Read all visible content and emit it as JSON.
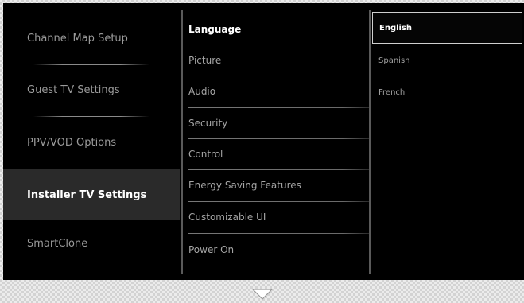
{
  "left_menu": {
    "items": [
      {
        "label": "Channel Map Setup"
      },
      {
        "label": "Guest TV Settings"
      },
      {
        "label": "PPV/VOD Options"
      },
      {
        "label": "Installer TV Settings",
        "selected": true
      },
      {
        "label": "SmartClone"
      }
    ]
  },
  "middle_menu": {
    "items": [
      {
        "label": "Language",
        "selected": true
      },
      {
        "label": "Picture"
      },
      {
        "label": "Audio"
      },
      {
        "label": "Security"
      },
      {
        "label": "Control"
      },
      {
        "label": "Energy Saving Features"
      },
      {
        "label": "Customizable UI"
      },
      {
        "label": "Power On"
      }
    ]
  },
  "right_menu": {
    "items": [
      {
        "label": "English",
        "selected": true
      },
      {
        "label": "Spanish"
      },
      {
        "label": "French"
      }
    ]
  },
  "scroll_indicator": {
    "icon": "chevron-down-outline-icon"
  },
  "colors": {
    "background": "#000000",
    "selected_row": "#2a2a2a",
    "text_selected": "#ffffff",
    "text_normal": "#9a9a9a"
  }
}
